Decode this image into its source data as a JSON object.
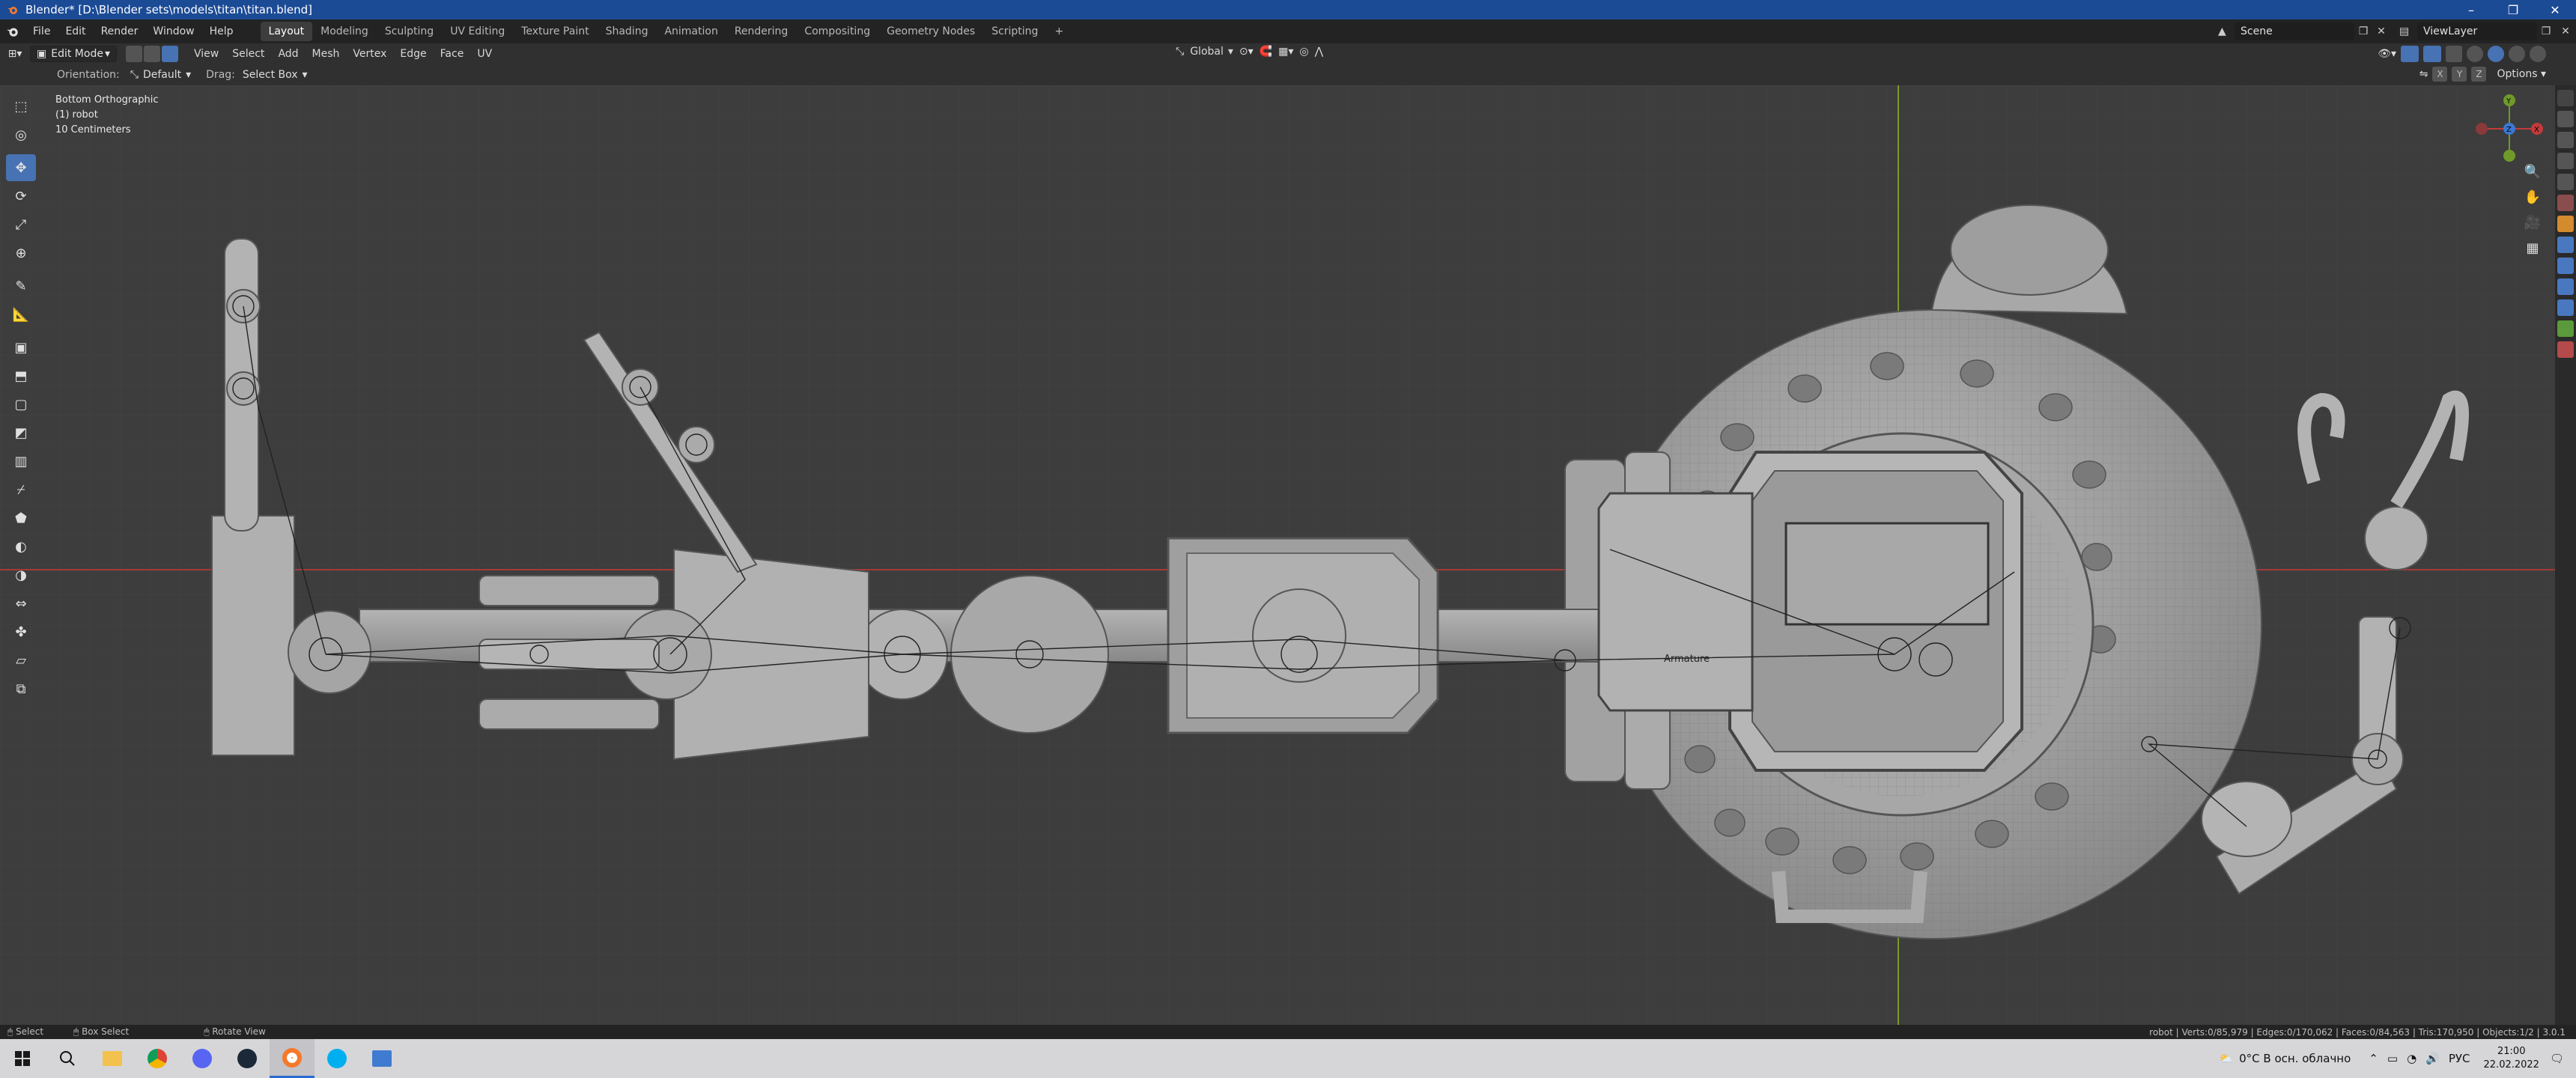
{
  "titlebar": {
    "title": "Blender* [D:\\Blender sets\\models\\titan\\titan.blend]",
    "minimize": "–",
    "maximize": "❐",
    "close": "✕"
  },
  "menu": {
    "items": [
      "File",
      "Edit",
      "Render",
      "Window",
      "Help"
    ]
  },
  "workspaces": [
    "Layout",
    "Modeling",
    "Sculpting",
    "UV Editing",
    "Texture Paint",
    "Shading",
    "Animation",
    "Rendering",
    "Compositing",
    "Geometry Nodes",
    "Scripting"
  ],
  "active_workspace": "Layout",
  "add_workspace": "+",
  "scene": {
    "label": "Scene"
  },
  "view_layer": {
    "label": "ViewLayer"
  },
  "header": {
    "mode": "Edit Mode",
    "menus": [
      "View",
      "Select",
      "Add",
      "Mesh",
      "Vertex",
      "Edge",
      "Face",
      "UV"
    ],
    "transform_orientation": "Global",
    "options": "Options",
    "axes": [
      "X",
      "Y",
      "Z"
    ]
  },
  "tool_settings": {
    "orientation_label": "Orientation:",
    "orientation_value": "Default",
    "drag_label": "Drag:",
    "drag_value": "Select Box"
  },
  "viewport": {
    "view_name": "Bottom Orthographic",
    "object": "(1) robot",
    "scale": "10 Centimeters",
    "armature_label": "Armature",
    "colors": {
      "background": "#3d3d3d",
      "grid": "#474747",
      "x_axis": "#a33a3a",
      "y_axis": "#7a9a2a"
    }
  },
  "gizmo": {
    "x": "X",
    "y": "Y",
    "z": "Z"
  },
  "statusbar": {
    "select": "Select",
    "box_select": "Box Select",
    "rotate_view": "Rotate View",
    "stats": "robot | Verts:0/85,979 | Edges:0/170,062 | Faces:0/84,563 | Tris:170,950 | Objects:1/2 | 3.0.1"
  },
  "taskbar": {
    "weather": "0°C  В осн. облачно",
    "language": "РУС",
    "time": "21:00",
    "date": "22.02.2022"
  }
}
